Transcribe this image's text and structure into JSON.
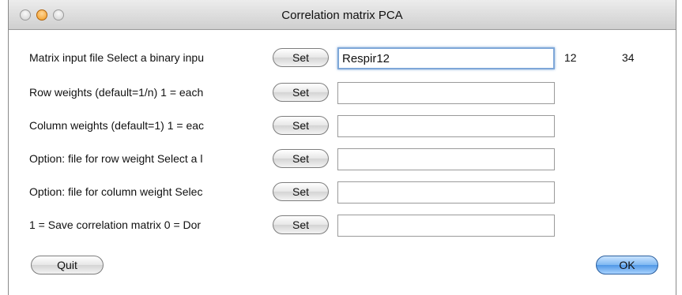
{
  "window": {
    "title": "Correlation matrix PCA"
  },
  "rows": [
    {
      "label": "Matrix input file Select a binary inpu",
      "button": "Set",
      "value": "Respir12",
      "extra": [
        "12",
        "34"
      ]
    },
    {
      "label": "Row weights (default=1/n) 1 = each",
      "button": "Set",
      "value": ""
    },
    {
      "label": "Column weights (default=1) 1 = eac",
      "button": "Set",
      "value": ""
    },
    {
      "label": "Option: file for row weight Select a l",
      "button": "Set",
      "value": ""
    },
    {
      "label": "Option: file for column weight Selec",
      "button": "Set",
      "value": ""
    },
    {
      "label": "1 = Save correlation matrix 0 = Dor",
      "button": "Set",
      "value": ""
    }
  ],
  "buttons": {
    "quit": "Quit",
    "ok": "OK"
  }
}
